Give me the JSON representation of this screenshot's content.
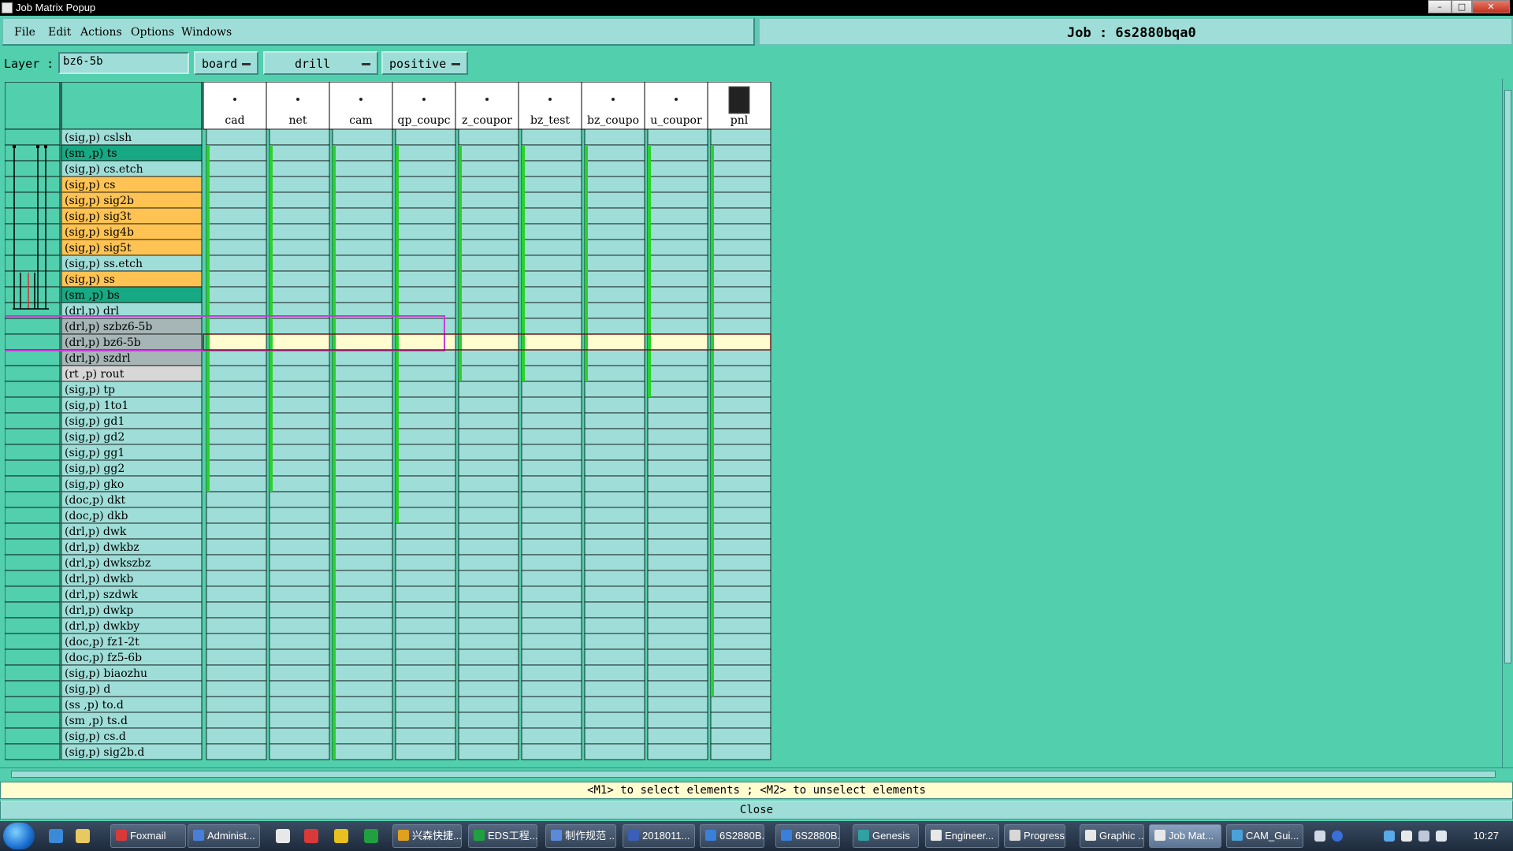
{
  "window": {
    "title": "Job Matrix Popup"
  },
  "menu": {
    "file": "File",
    "edit": "Edit",
    "actions": "Actions",
    "options": "Options",
    "windows": "Windows"
  },
  "job": {
    "label": "Job : 6s2880bqa0"
  },
  "layer_bar": {
    "label": "Layer :",
    "value": "bz6-5b",
    "context": "board",
    "type": "drill",
    "polarity": "positive"
  },
  "steps": [
    "cad",
    "net",
    "cam",
    "qp_coupc",
    "z_coupor",
    "bz_test",
    "bz_coupo",
    "u_coupor",
    "pnl"
  ],
  "layers": [
    {
      "label": "(sig,p) cslsh",
      "color": "teal"
    },
    {
      "label": "(sm ,p) ts",
      "color": "green"
    },
    {
      "label": "(sig,p) cs.etch",
      "color": "teal"
    },
    {
      "label": "(sig,p) cs",
      "color": "orange"
    },
    {
      "label": "(sig,p) sig2b",
      "color": "orange"
    },
    {
      "label": "(sig,p) sig3t",
      "color": "orange"
    },
    {
      "label": "(sig,p) sig4b",
      "color": "orange"
    },
    {
      "label": "(sig,p) sig5t",
      "color": "orange"
    },
    {
      "label": "(sig,p) ss.etch",
      "color": "teal"
    },
    {
      "label": "(sig,p) ss",
      "color": "orange"
    },
    {
      "label": "(sm ,p) bs",
      "color": "green"
    },
    {
      "label": "(drl,p) drl",
      "color": "teal"
    },
    {
      "label": "(drl,p) szbz6-5b",
      "color": "gray"
    },
    {
      "label": "(drl,p) bz6-5b",
      "color": "gray"
    },
    {
      "label": "(drl,p) szdrl",
      "color": "gray"
    },
    {
      "label": "(rt ,p) rout",
      "color": "lightgray"
    },
    {
      "label": "(sig,p) tp",
      "color": "teal"
    },
    {
      "label": "(sig,p) 1to1",
      "color": "teal"
    },
    {
      "label": "(sig,p) gd1",
      "color": "teal"
    },
    {
      "label": "(sig,p) gd2",
      "color": "teal"
    },
    {
      "label": "(sig,p) gg1",
      "color": "teal"
    },
    {
      "label": "(sig,p) gg2",
      "color": "teal"
    },
    {
      "label": "(sig,p) gko",
      "color": "teal"
    },
    {
      "label": "(doc,p) dkt",
      "color": "teal"
    },
    {
      "label": "(doc,p) dkb",
      "color": "teal"
    },
    {
      "label": "(drl,p) dwk",
      "color": "teal"
    },
    {
      "label": "(drl,p) dwkbz",
      "color": "teal"
    },
    {
      "label": "(drl,p) dwkszbz",
      "color": "teal"
    },
    {
      "label": "(drl,p) dwkb",
      "color": "teal"
    },
    {
      "label": "(drl,p) szdwk",
      "color": "teal"
    },
    {
      "label": "(drl,p) dwkp",
      "color": "teal"
    },
    {
      "label": "(drl,p) dwkby",
      "color": "teal"
    },
    {
      "label": "(doc,p) fz1-2t",
      "color": "teal"
    },
    {
      "label": "(doc,p) fz5-6b",
      "color": "teal"
    },
    {
      "label": "(sig,p) biaozhu",
      "color": "teal"
    },
    {
      "label": "(sig,p) d",
      "color": "teal"
    },
    {
      "label": "(ss ,p) to.d",
      "color": "teal"
    },
    {
      "label": "(sm ,p) ts.d",
      "color": "teal"
    },
    {
      "label": "(sig,p) cs.d",
      "color": "teal"
    },
    {
      "label": "(sig,p) sig2b.d",
      "color": "teal"
    }
  ],
  "selected_row": 13,
  "colors": {
    "background": "#52cfad",
    "cell": "#9fded8",
    "orange": "#fec352",
    "green": "#16a983",
    "gray": "#a6b5b5",
    "lightgray": "#d7d7d7",
    "highlight": "#fffccf",
    "selection_outline": "#c33fd2",
    "marker": "#2bd12b"
  },
  "status": {
    "hint": "<M1> to select elements ; <M2> to unselect elements",
    "close": "Close"
  },
  "taskbar": {
    "items": [
      "Foxmail",
      "Administ...",
      "兴森快捷...",
      "EDS工程...",
      "制作规范 ...",
      "2018011...",
      "6S2880B...",
      "6S2880B...",
      "Genesis",
      "Engineer...",
      "Progress",
      "Graphic ...",
      "Job Mat...",
      "CAM_Gui..."
    ],
    "clock": "10:27"
  }
}
